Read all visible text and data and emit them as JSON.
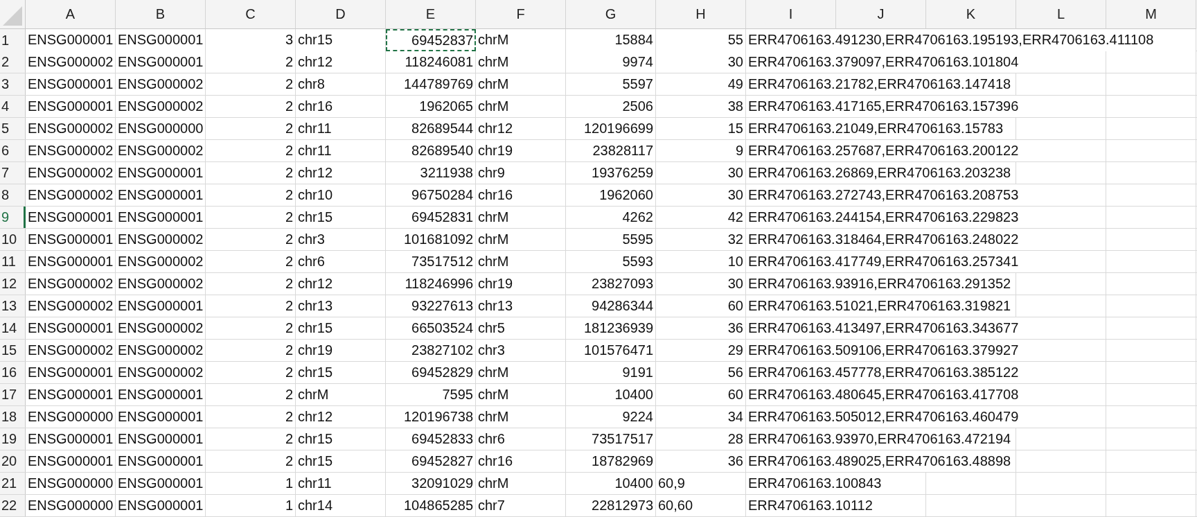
{
  "columns": [
    "A",
    "B",
    "C",
    "D",
    "E",
    "F",
    "G",
    "H",
    "I",
    "J",
    "K",
    "L",
    "M"
  ],
  "rows": [
    {
      "number": "1",
      "selected": false,
      "cells": [
        "ENSG000001",
        "ENSG000001",
        "3",
        "chr15",
        {
          "text": "69452837",
          "copied": true
        },
        "chrM",
        "15884",
        "55",
        "ERR4706163.491230,ERR4706163.195193,ERR4706163.411108"
      ]
    },
    {
      "number": "2",
      "selected": false,
      "cells": [
        "ENSG000002",
        "ENSG000001",
        "2",
        "chr12",
        "118246081",
        "chrM",
        "9974",
        "30",
        "ERR4706163.379097,ERR4706163.101804"
      ]
    },
    {
      "number": "3",
      "selected": false,
      "cells": [
        "ENSG000001",
        "ENSG000002",
        "2",
        "chr8",
        "144789769",
        "chrM",
        "5597",
        "49",
        "ERR4706163.21782,ERR4706163.147418"
      ]
    },
    {
      "number": "4",
      "selected": false,
      "cells": [
        "ENSG000001",
        "ENSG000002",
        "2",
        "chr16",
        "1962065",
        "chrM",
        "2506",
        "38",
        "ERR4706163.417165,ERR4706163.157396"
      ]
    },
    {
      "number": "5",
      "selected": false,
      "cells": [
        "ENSG000002",
        "ENSG000000",
        "2",
        "chr11",
        "82689544",
        "chr12",
        "120196699",
        "15",
        "ERR4706163.21049,ERR4706163.15783"
      ]
    },
    {
      "number": "6",
      "selected": false,
      "cells": [
        "ENSG000002",
        "ENSG000002",
        "2",
        "chr11",
        "82689540",
        "chr19",
        "23828117",
        "9",
        "ERR4706163.257687,ERR4706163.200122"
      ]
    },
    {
      "number": "7",
      "selected": false,
      "cells": [
        "ENSG000002",
        "ENSG000001",
        "2",
        "chr12",
        "3211938",
        "chr9",
        "19376259",
        "30",
        "ERR4706163.26869,ERR4706163.203238"
      ]
    },
    {
      "number": "8",
      "selected": false,
      "cells": [
        "ENSG000002",
        "ENSG000001",
        "2",
        "chr10",
        "96750284",
        "chr16",
        "1962060",
        "30",
        "ERR4706163.272743,ERR4706163.208753"
      ]
    },
    {
      "number": "9",
      "selected": true,
      "cells": [
        "ENSG000001",
        "ENSG000001",
        "2",
        "chr15",
        "69452831",
        "chrM",
        "4262",
        "42",
        "ERR4706163.244154,ERR4706163.229823"
      ]
    },
    {
      "number": "10",
      "selected": false,
      "cells": [
        "ENSG000001",
        "ENSG000002",
        "2",
        "chr3",
        "101681092",
        "chrM",
        "5595",
        "32",
        "ERR4706163.318464,ERR4706163.248022"
      ]
    },
    {
      "number": "11",
      "selected": false,
      "cells": [
        "ENSG000001",
        "ENSG000002",
        "2",
        "chr6",
        "73517512",
        "chrM",
        "5593",
        "10",
        "ERR4706163.417749,ERR4706163.257341"
      ]
    },
    {
      "number": "12",
      "selected": false,
      "cells": [
        "ENSG000002",
        "ENSG000002",
        "2",
        "chr12",
        "118246996",
        "chr19",
        "23827093",
        "30",
        "ERR4706163.93916,ERR4706163.291352"
      ]
    },
    {
      "number": "13",
      "selected": false,
      "cells": [
        "ENSG000002",
        "ENSG000001",
        "2",
        "chr13",
        "93227613",
        "chr13",
        "94286344",
        "60",
        "ERR4706163.51021,ERR4706163.319821"
      ]
    },
    {
      "number": "14",
      "selected": false,
      "cells": [
        "ENSG000001",
        "ENSG000002",
        "2",
        "chr15",
        "66503524",
        "chr5",
        "181236939",
        "36",
        "ERR4706163.413497,ERR4706163.343677"
      ]
    },
    {
      "number": "15",
      "selected": false,
      "cells": [
        "ENSG000002",
        "ENSG000002",
        "2",
        "chr19",
        "23827102",
        "chr3",
        "101576471",
        "29",
        "ERR4706163.509106,ERR4706163.379927"
      ]
    },
    {
      "number": "16",
      "selected": false,
      "cells": [
        "ENSG000001",
        "ENSG000002",
        "2",
        "chr15",
        "69452829",
        "chrM",
        "9191",
        "56",
        "ERR4706163.457778,ERR4706163.385122"
      ]
    },
    {
      "number": "17",
      "selected": false,
      "cells": [
        "ENSG000001",
        "ENSG000001",
        "2",
        "chrM",
        "7595",
        "chrM",
        "10400",
        "60",
        "ERR4706163.480645,ERR4706163.417708"
      ]
    },
    {
      "number": "18",
      "selected": false,
      "cells": [
        "ENSG000000",
        "ENSG000001",
        "2",
        "chr12",
        "120196738",
        "chrM",
        "9224",
        "34",
        "ERR4706163.505012,ERR4706163.460479"
      ]
    },
    {
      "number": "19",
      "selected": false,
      "cells": [
        "ENSG000001",
        "ENSG000001",
        "2",
        "chr15",
        "69452833",
        "chr6",
        "73517517",
        "28",
        "ERR4706163.93970,ERR4706163.472194"
      ]
    },
    {
      "number": "20",
      "selected": false,
      "cells": [
        "ENSG000001",
        "ENSG000001",
        "2",
        "chr15",
        "69452827",
        "chr16",
        "18782969",
        "36",
        "ERR4706163.489025,ERR4706163.48898"
      ]
    },
    {
      "number": "21",
      "selected": false,
      "cells": [
        "ENSG000000",
        "ENSG000001",
        "1",
        "chr11",
        "32091029",
        "chrM",
        "10400",
        "60,9",
        "ERR4706163.100843"
      ]
    },
    {
      "number": "22",
      "selected": false,
      "cells": [
        "ENSG000000",
        "ENSG000001",
        "1",
        "chr14",
        "104865285",
        "chr7",
        "22812973",
        "60,60",
        "ERR4706163.10112"
      ]
    }
  ]
}
